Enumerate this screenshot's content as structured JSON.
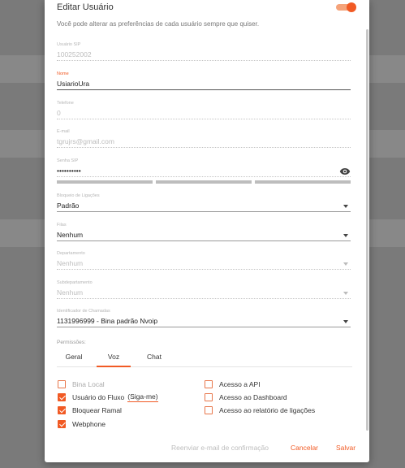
{
  "dialog": {
    "title": "Editar Usuário",
    "subtitle": "Você pode alterar as preferências de cada usuário sempre que quiser.",
    "active_toggle_on": true
  },
  "fields": {
    "sip_user": {
      "label": "Usuário SIP",
      "value": "100252002"
    },
    "name": {
      "label": "Nome",
      "value": "UsiarioUra"
    },
    "phone": {
      "label": "Telefone",
      "value": "0"
    },
    "email": {
      "label": "E-mail",
      "value": "tgrujrs@gmail.com"
    },
    "sip_password": {
      "label": "Senha SIP",
      "value": "••••••••••"
    },
    "call_block": {
      "label": "Bloqueio de Ligações",
      "value": "Padrão"
    },
    "queue": {
      "label": "Filas",
      "value": "Nenhum"
    },
    "department": {
      "label": "Departamento",
      "value": "Nenhum"
    },
    "subdepartment": {
      "label": "Subdepartamento",
      "value": "Nenhum"
    },
    "caller_id": {
      "label": "Identificador de Chamadas",
      "value": "1131996999 - Bina padrão Nvoip"
    }
  },
  "permissions": {
    "label": "Permissões:",
    "tabs": [
      "Geral",
      "Voz",
      "Chat"
    ],
    "active_tab": "Voz",
    "left": [
      {
        "label": "Bina Local",
        "checked": false,
        "disabled": true
      },
      {
        "label": "Usuário do Fluxo",
        "checked": true,
        "extra": "(Siga-me)"
      },
      {
        "label": "Bloquear Ramal",
        "checked": true
      },
      {
        "label": "Webphone",
        "checked": true
      }
    ],
    "right": [
      {
        "label": "Acesso a API",
        "checked": false
      },
      {
        "label": "Acesso ao Dashboard",
        "checked": false
      },
      {
        "label": "Acesso ao relatório de ligações",
        "checked": false
      }
    ]
  },
  "footer": {
    "resend_label": "Reenviar e-mail de confirmação",
    "cancel_label": "Cancelar",
    "save_label": "Salvar"
  },
  "colors": {
    "accent": "#f15a24",
    "backdrop": "#7a7a7a"
  }
}
